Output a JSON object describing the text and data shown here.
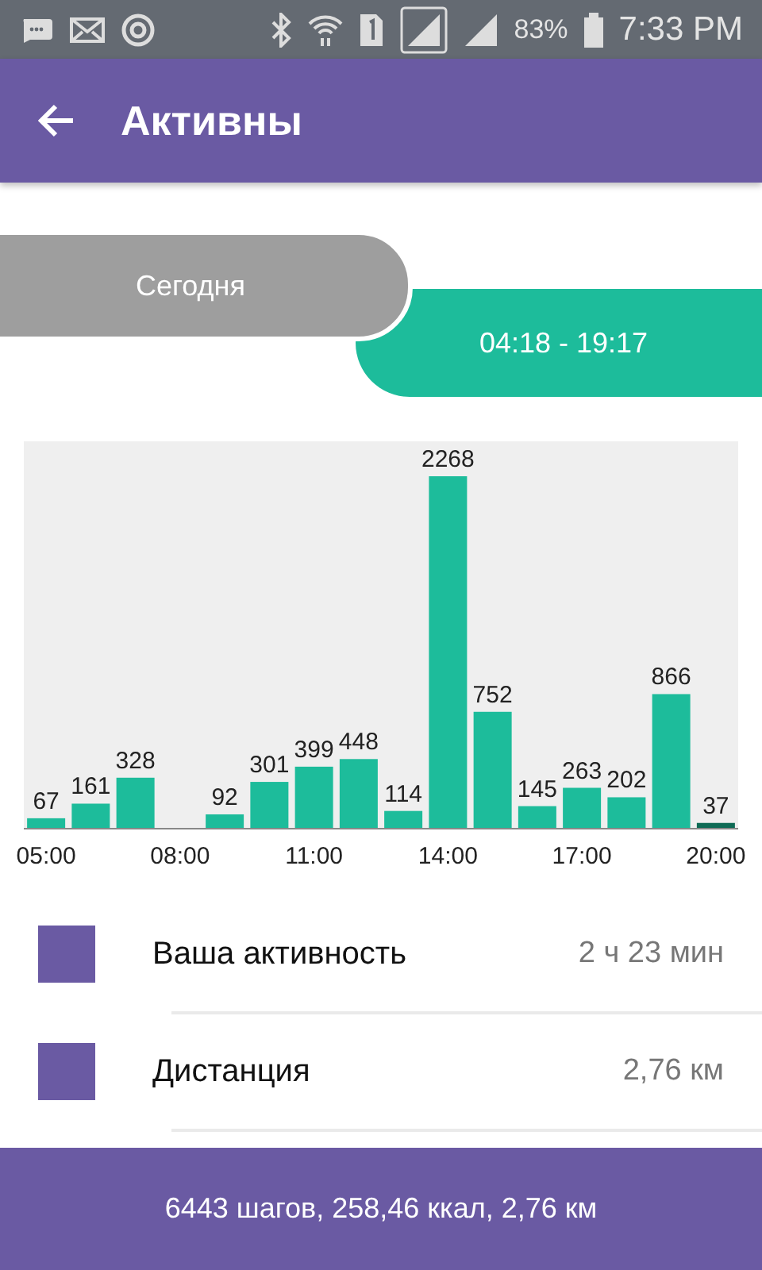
{
  "status_bar": {
    "battery": "83%",
    "time": "7:33 PM"
  },
  "app_bar": {
    "title": "Активны"
  },
  "tabs": [
    {
      "label": "Сегодня",
      "selected": false
    },
    {
      "label": "04:18 - 19:17",
      "selected": true
    }
  ],
  "chart": {
    "chart_data": {
      "type": "bar",
      "x": [
        5,
        6,
        7,
        8,
        9,
        10,
        11,
        12,
        13,
        14,
        15,
        16,
        17,
        18,
        19,
        20
      ],
      "series": [
        {
          "color": "#1dbc9b",
          "values": [
            67,
            161,
            328,
            null,
            92,
            301,
            399,
            448,
            114,
            2268,
            752,
            145,
            263,
            202,
            866,
            null
          ]
        },
        {
          "color": "#0e6b55",
          "values": [
            null,
            null,
            null,
            null,
            null,
            null,
            null,
            null,
            null,
            null,
            null,
            null,
            null,
            null,
            null,
            37
          ]
        }
      ],
      "xlim": [
        4.5,
        20.5
      ],
      "xticks": [
        {
          "value": 5,
          "label": "05:00"
        },
        {
          "value": 8,
          "label": "08:00"
        },
        {
          "value": 11,
          "label": "11:00"
        },
        {
          "value": 14,
          "label": "14:00"
        },
        {
          "value": 17,
          "label": "17:00"
        },
        {
          "value": 20,
          "label": "20:00"
        }
      ],
      "data_labels": true
    }
  },
  "legend": [
    {
      "label": "Ваша активность",
      "value": "2 ч 23 мин",
      "color": "#6a5aa3"
    },
    {
      "label": "Дистанция",
      "value": "2,76 км",
      "color": "#6a5aa3"
    }
  ],
  "summary": "6443 шагов, 258,46 ккал, 2,76 км"
}
